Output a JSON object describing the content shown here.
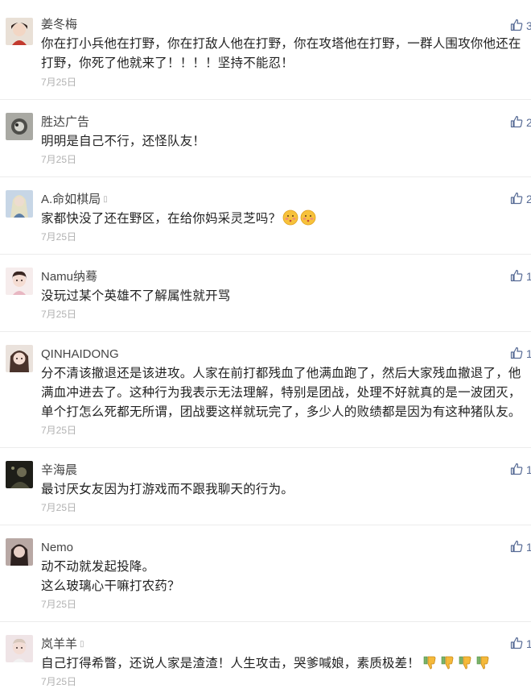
{
  "comments": [
    {
      "username": "姜冬梅",
      "lines": [
        "你在打小兵他在打野，你在打敌人他在打野，你在攻塔他在打野，一群人围攻你他还在",
        "打野，你死了他就来了！！！！坚持不能忍！"
      ],
      "date": "7月25日",
      "likes": "3",
      "avatar_color": "#8a5a4a"
    },
    {
      "username": "胜达广告",
      "lines": [
        "明明是自己不行，还怪队友！"
      ],
      "date": "7月25日",
      "likes": "2",
      "avatar_color": "#7d7d7d"
    },
    {
      "username": "A.命如棋局",
      "badge": "▯",
      "lines": [
        "家都快没了还在野区，在给你妈采灵芝吗？"
      ],
      "emojis": [
        "blush-emoji",
        "blush-emoji"
      ],
      "date": "7月25日",
      "likes": "2",
      "avatar_color": "#6b8fb5"
    },
    {
      "username": "Namu纳蓦",
      "lines": [
        "没玩过某个英雄不了解属性就开骂"
      ],
      "date": "7月25日",
      "likes": "1",
      "avatar_color": "#e8c9c9"
    },
    {
      "username": "QINHAIDONG",
      "lines": [
        "分不清该撤退还是该进攻。人家在前打都残血了他满血跑了，然后大家残血撤退了，他",
        "满血冲进去了。这种行为我表示无法理解，特别是团战，处理不好就真的是一波团灭，",
        "单个打怎么死都无所谓，团战要这样就玩完了，多少人的败绩都是因为有这种猪队友。"
      ],
      "date": "7月25日",
      "likes": "1",
      "avatar_color": "#c9b6a8"
    },
    {
      "username": "辛海晨",
      "lines": [
        "最讨厌女友因为打游戏而不跟我聊天的行为。"
      ],
      "date": "7月25日",
      "likes": "1",
      "avatar_color": "#3a3a2e"
    },
    {
      "username": "Nemo",
      "lines": [
        "动不动就发起投降。",
        "这么玻璃心干嘛打农药？"
      ],
      "date": "7月25日",
      "likes": "1",
      "avatar_color": "#5a4a48"
    },
    {
      "username": "岚羊羊",
      "badge": "▯",
      "lines": [
        "自己打得希瞥，还说人家是渣渣！人生攻击，哭爹喊娘，素质极差！"
      ],
      "emojis": [
        "thumbs-down-emoji",
        "thumbs-down-emoji",
        "thumbs-down-emoji",
        "thumbs-down-emoji"
      ],
      "date": "7月25日",
      "likes": "1",
      "avatar_color": "#d9c2c8"
    }
  ],
  "colors": {
    "username": "#444444",
    "content": "#222222",
    "date": "#b2b2b2",
    "like": "#576b95",
    "divider": "#ececec"
  }
}
